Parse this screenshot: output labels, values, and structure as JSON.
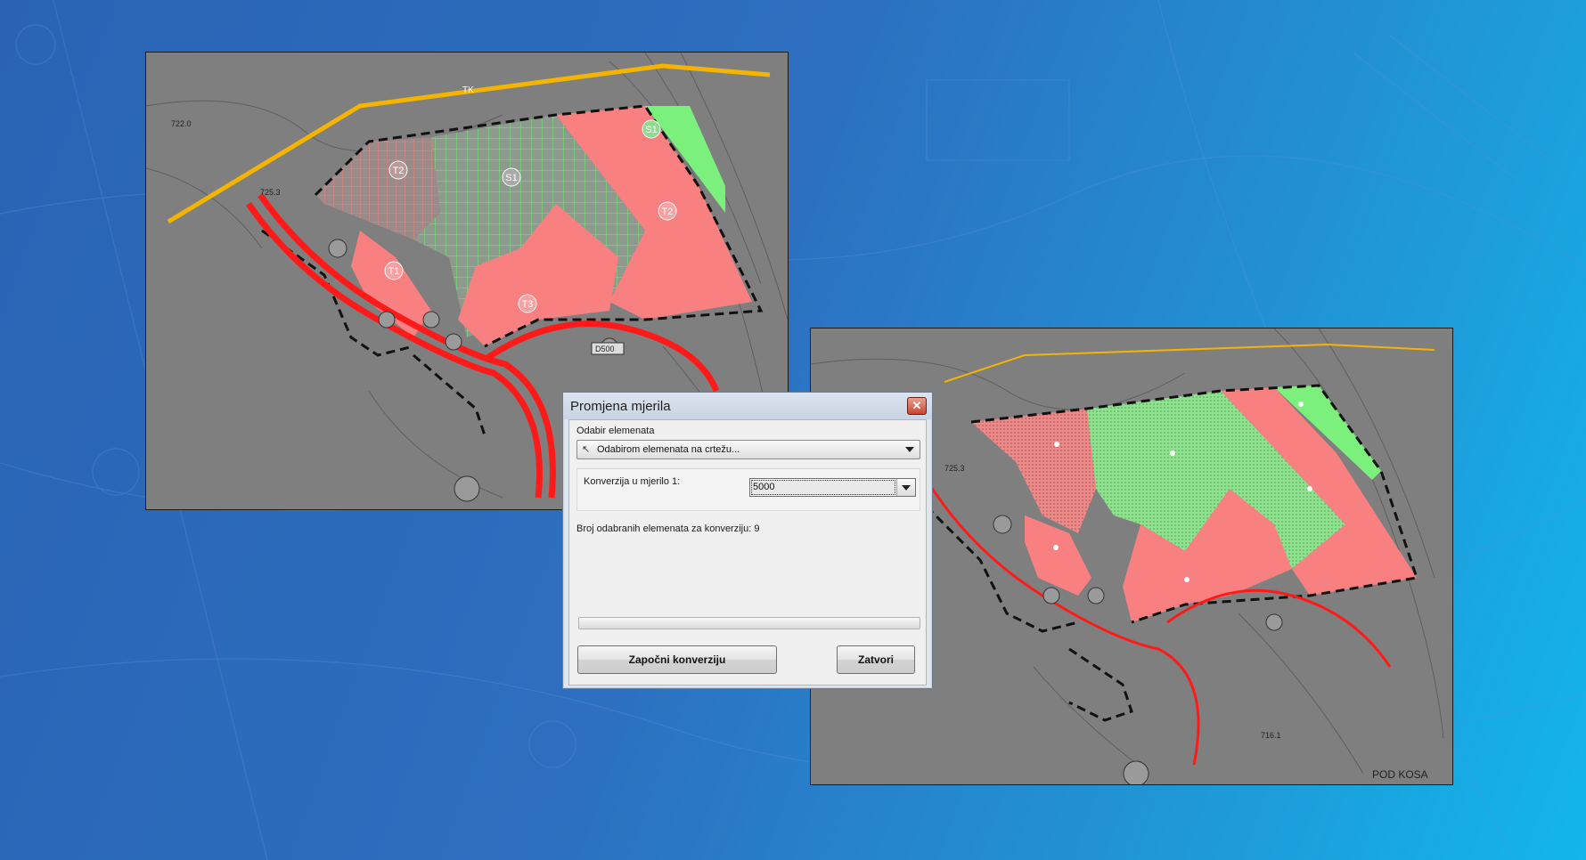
{
  "dialog": {
    "title": "Promjena mjerila",
    "close_glyph": "✕",
    "selection_label": "Odabir elemenata",
    "selection_value": "Odabirom elemenata na crtežu...",
    "selection_icon": "cursor-icon",
    "scale_label": "Konverzija u mjerilo 1:",
    "scale_value": "5000",
    "count_text": "Broj odabranih elemenata za konverziju: 9",
    "start_button": "Započni konverziju",
    "close_button": "Zatvori",
    "progress": 0
  },
  "map_left": {
    "zone_labels": [
      "S1",
      "S1",
      "T2",
      "T2",
      "T1",
      "T3"
    ],
    "road_labels": [
      "TK",
      "D500"
    ],
    "contour_labels": [
      "722.0",
      "725.3"
    ]
  },
  "map_right": {
    "place_label": "POD KOSA",
    "contour_labels": [
      "725.3",
      "716.1"
    ]
  },
  "colors": {
    "zone_red": "#f98080",
    "zone_green": "#7cf07c",
    "road_red": "#ff1a1a",
    "power_line": "#f5b400",
    "map_gray": "#7f7f7f"
  }
}
